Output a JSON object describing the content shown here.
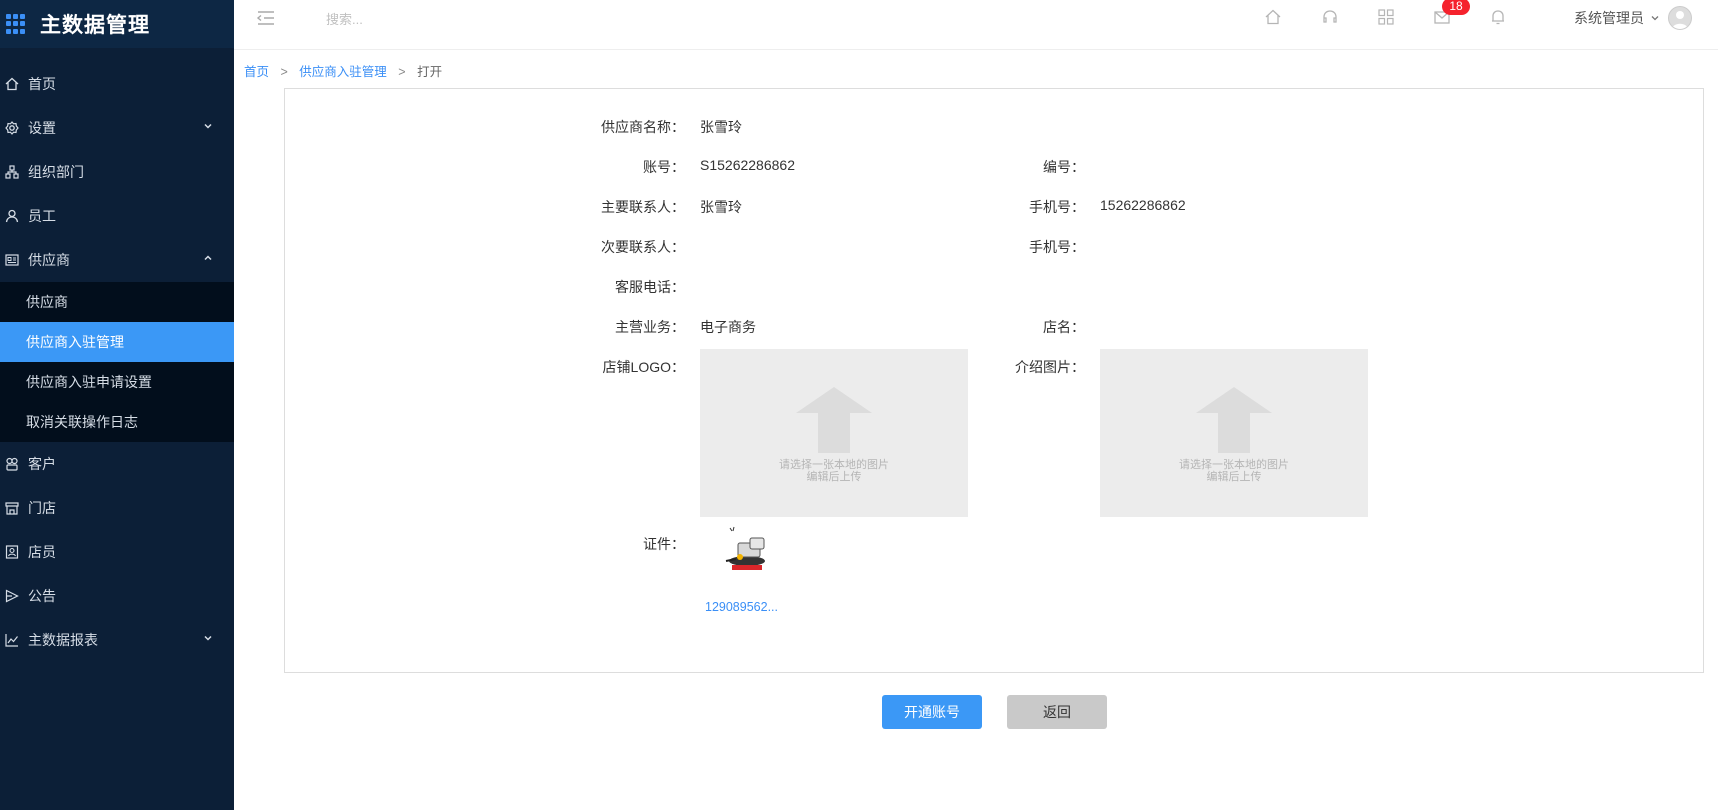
{
  "app": {
    "title": "主数据管理"
  },
  "header": {
    "search_placeholder": "搜索...",
    "mail_badge": "18",
    "user_name": "系统管理员"
  },
  "sidebar": {
    "items": [
      {
        "label": "首页",
        "icon": "home-icon"
      },
      {
        "label": "设置",
        "icon": "gear-icon"
      },
      {
        "label": "组织部门",
        "icon": "org-icon"
      },
      {
        "label": "员工",
        "icon": "user-icon"
      },
      {
        "label": "供应商",
        "icon": "id-card-icon"
      },
      {
        "label": "客户",
        "icon": "customers-icon"
      },
      {
        "label": "门店",
        "icon": "store-icon"
      },
      {
        "label": "店员",
        "icon": "clerk-icon"
      },
      {
        "label": "公告",
        "icon": "megaphone-icon"
      },
      {
        "label": "主数据报表",
        "icon": "chart-icon"
      }
    ],
    "supplier_sub": [
      {
        "label": "供应商"
      },
      {
        "label": "供应商入驻管理",
        "active": true
      },
      {
        "label": "供应商入驻申请设置"
      },
      {
        "label": "取消关联操作日志"
      }
    ]
  },
  "breadcrumb": {
    "home": "首页",
    "parent": "供应商入驻管理",
    "current": "打开",
    "sep": ">"
  },
  "form": {
    "supplier_name_label": "供应商名称：",
    "supplier_name": "张雪玲",
    "account_label": "账号：",
    "account": "S15262286862",
    "code_label": "编号：",
    "code": "",
    "primary_contact_label": "主要联系人：",
    "primary_contact": "张雪玲",
    "mobile_label": "手机号：",
    "mobile": "15262286862",
    "secondary_contact_label": "次要联系人：",
    "secondary_contact": "",
    "mobile2_label": "手机号：",
    "mobile2": "",
    "service_phone_label": "客服电话：",
    "service_phone": "",
    "main_business_label": "主营业务：",
    "main_business": "电子商务",
    "shop_name_label": "店名：",
    "shop_name": "",
    "shop_logo_label": "店铺LOGO：",
    "intro_image_label": "介绍图片：",
    "upload_hint_line1": "请选择一张本地的图片",
    "upload_hint_line2": "编辑后上传",
    "certificate_label": "证件：",
    "certificate_file": "129089562..."
  },
  "buttons": {
    "open_account": "开通账号",
    "back": "返回"
  },
  "colors": {
    "sidebar_bg": "#0c1f37",
    "accent": "#3b98f6",
    "badge": "#f5222d"
  }
}
